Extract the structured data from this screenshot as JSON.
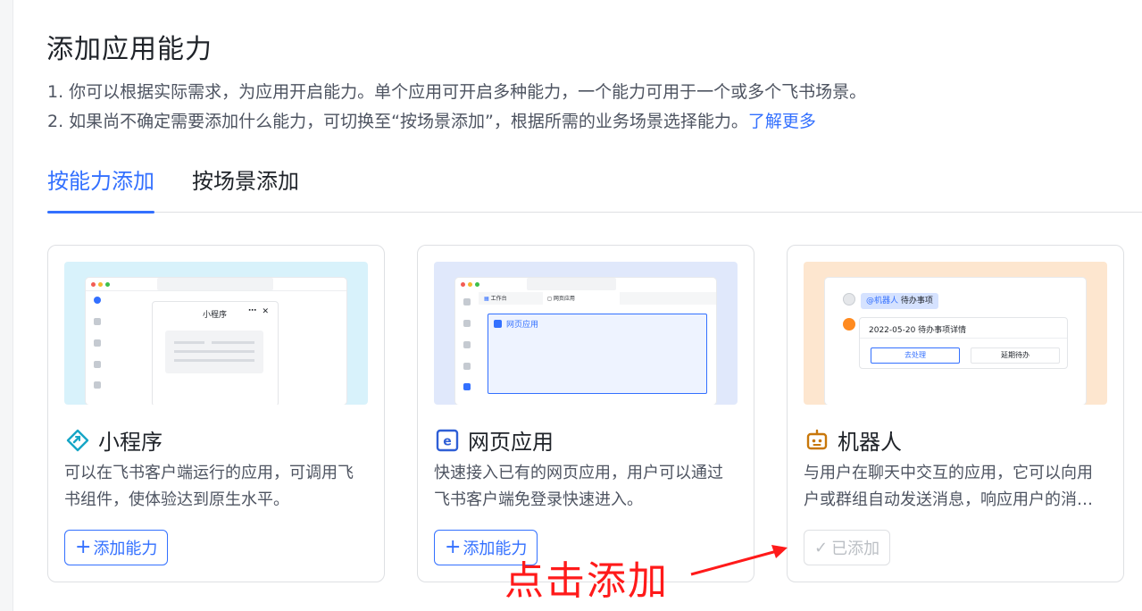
{
  "header": {
    "title": "添加应用能力",
    "desc_line1": "1. 你可以根据实际需求，为应用开启能力。单个应用可开启多种能力，一个能力可用于一个或多个飞书场景。",
    "desc_line2_prefix": "2. 如果尚不确定需要添加什么能力，可切换至“按场景添加”，根据所需的业务场景选择能力。",
    "desc_line2_link": "了解更多"
  },
  "tabs": [
    {
      "label": "按能力添加",
      "active": true
    },
    {
      "label": "按场景添加",
      "active": false
    }
  ],
  "cards": [
    {
      "icon": "mini-program-icon",
      "title": "小程序",
      "desc_line1": "可以在飞书客户端运行的应用，可调用飞",
      "desc_line2": "书组件，使体验达到原生水平。",
      "button_label": "添加能力",
      "button_state": "enabled",
      "preview": {
        "popup_title": "小程序"
      }
    },
    {
      "icon": "web-app-icon",
      "title": "网页应用",
      "desc_line1": "快速接入已有的网页应用，用户可以通过",
      "desc_line2": "飞书客户端免登录快速进入。",
      "button_label": "添加能力",
      "button_state": "enabled",
      "preview": {
        "tab1": "工作台",
        "tab2": "网页应用",
        "panel_label": "网页应用"
      }
    },
    {
      "icon": "robot-icon",
      "title": "机器人",
      "desc_line1": "与用户在聊天中交互的应用，它可以向用",
      "desc_line2": "户或群组自动发送消息，响应用户的消息。",
      "button_label": "已添加",
      "button_state": "added",
      "preview": {
        "mention": "@机器人",
        "mention_text": "待办事项",
        "task_title": "2022-05-20 待办事项详情",
        "btn_primary": "去处理",
        "btn_secondary": "延期待办"
      }
    }
  ],
  "annotation": {
    "text": "点击添加",
    "color": "#ff1a1a"
  },
  "colors": {
    "accent": "#3370ff",
    "text": "#1f2329",
    "muted": "#4e5461",
    "border": "#dee0e3"
  }
}
